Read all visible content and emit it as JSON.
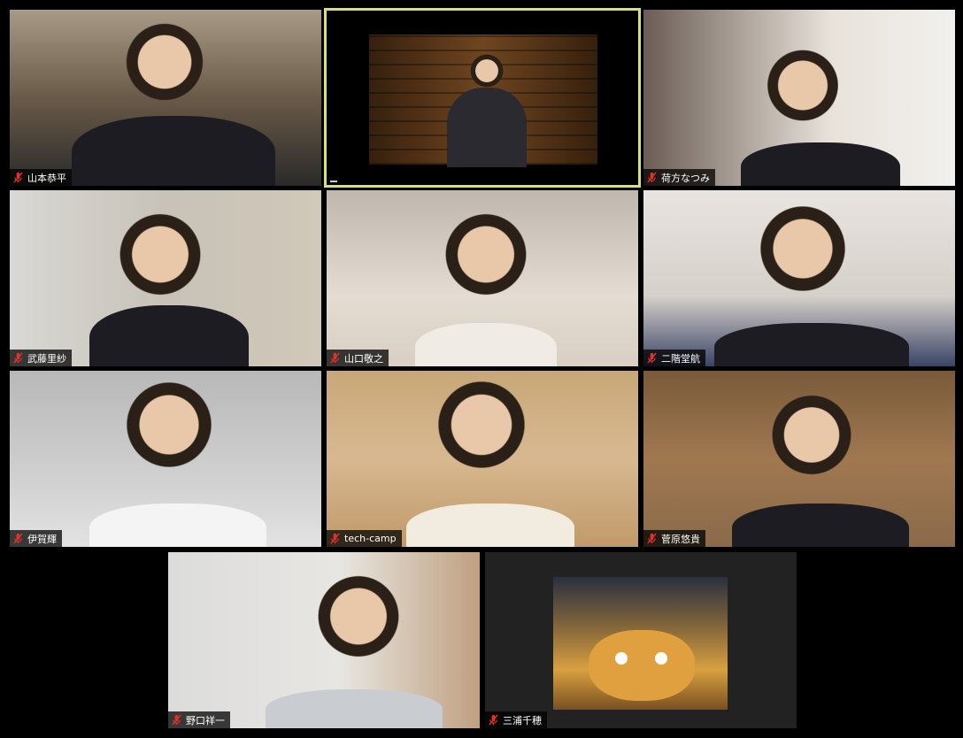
{
  "participants": [
    {
      "name": "山本恭平",
      "muted": true
    },
    {
      "name": "",
      "muted": false
    },
    {
      "name": "荷方なつみ",
      "muted": true
    },
    {
      "name": "武藤里紗",
      "muted": true
    },
    {
      "name": "山口敬之",
      "muted": true
    },
    {
      "name": "二階堂航",
      "muted": true
    },
    {
      "name": "伊賀輝",
      "muted": true
    },
    {
      "name": "tech-camp",
      "muted": true
    },
    {
      "name": "菅原悠貴",
      "muted": true
    },
    {
      "name": "野口祥一",
      "muted": true
    },
    {
      "name": "三浦千穂",
      "muted": true
    }
  ],
  "colors": {
    "active_speaker_border": "#d9e36a",
    "mute_icon": "#e0322a"
  }
}
